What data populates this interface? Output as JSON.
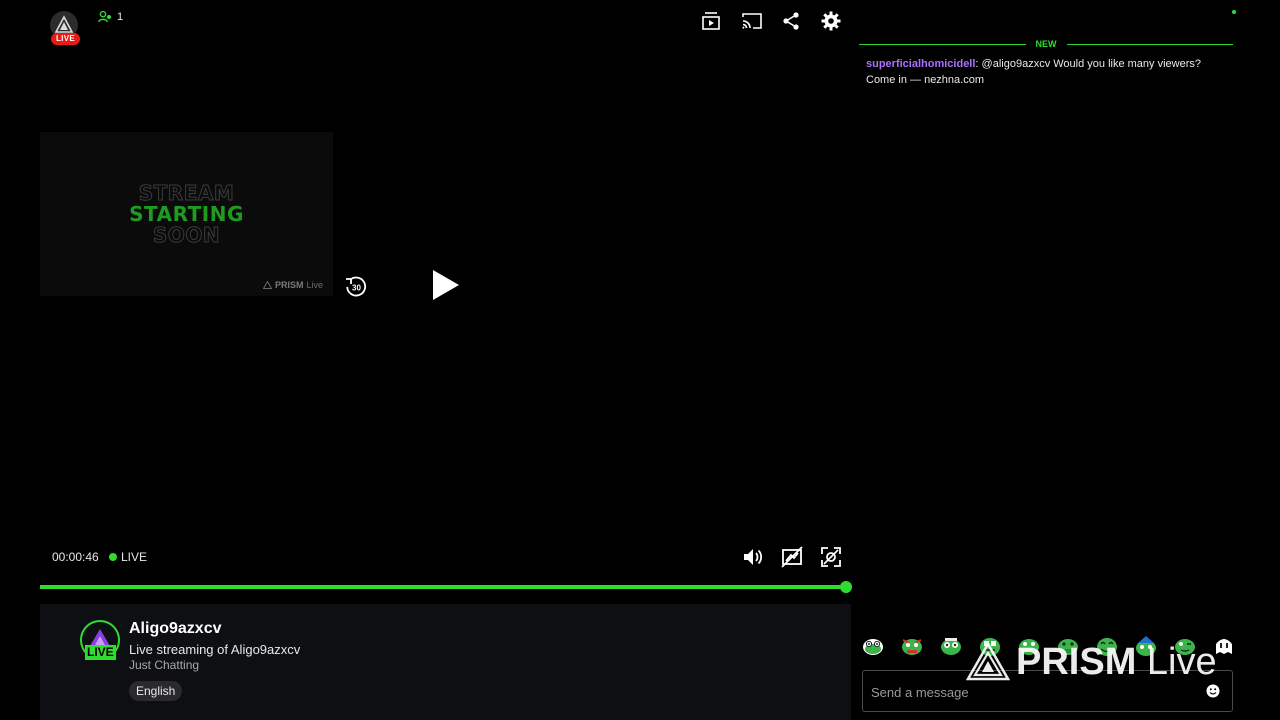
{
  "viewer_count": "1",
  "top_live_label": "LIVE",
  "thumbnail": {
    "line1": "STREAM",
    "line2": "STARTING",
    "line3": "SOON",
    "watermark_brand": "PRISM",
    "watermark_suffix": "Live"
  },
  "player": {
    "rewind_label": "30",
    "elapsed": "00:00:46",
    "live_label": "LIVE",
    "progress_fraction": 1.0
  },
  "channel": {
    "name": "Aligo9azxcv",
    "title": "Live streaming of Aligo9azxcv",
    "category": "Just Chatting",
    "tag": "English",
    "avatar_live": "LIVE"
  },
  "chat": {
    "divider_label": "NEW",
    "messages": [
      {
        "user": "superficialhomicidell",
        "text": "@aligo9azxcv Would you like many viewers? Come in — nezhna.com"
      }
    ],
    "placeholder": "Send a message"
  },
  "overlay": {
    "brand": "PRISM",
    "suffix": "Live"
  },
  "colors": {
    "accent": "#2fdc2f",
    "live_red": "#e91916",
    "username": "#a970ff"
  },
  "icons": {
    "top": [
      "theatre-mode-icon",
      "cast-icon",
      "share-icon",
      "settings-icon"
    ],
    "bottom": [
      "volume-icon",
      "clip-icon",
      "fullscreen-icon"
    ]
  }
}
